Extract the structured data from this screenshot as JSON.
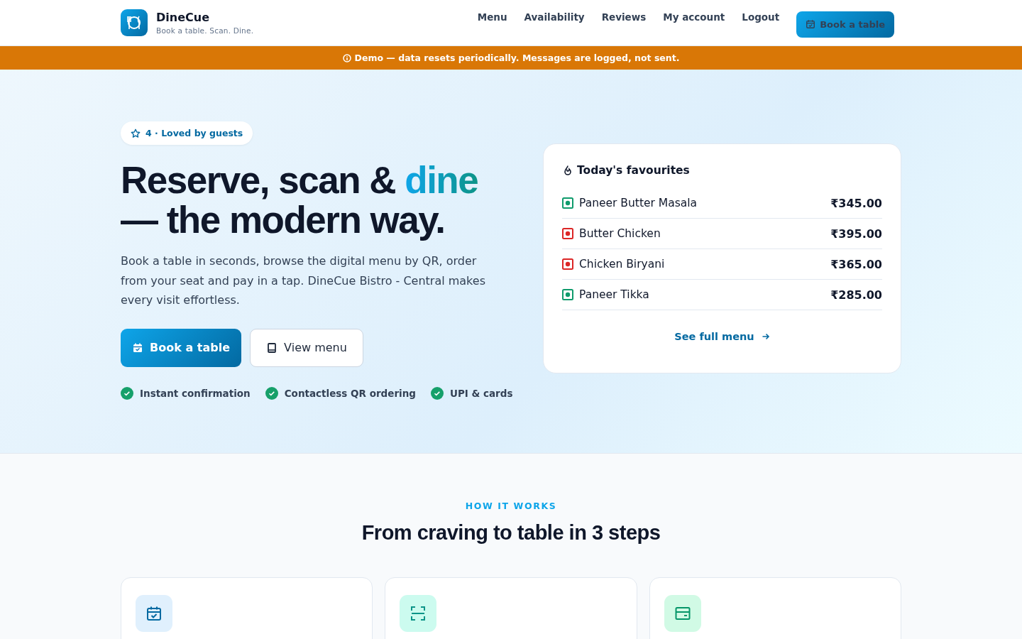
{
  "brand": {
    "name": "DineCue",
    "tagline": "Book a table. Scan. Dine."
  },
  "nav": {
    "links": [
      "Menu",
      "Availability",
      "Reviews",
      "My account",
      "Logout"
    ],
    "cta": "Book a table"
  },
  "banner": "Demo — data resets periodically. Messages are logged, not sent.",
  "hero": {
    "badge": "4 · Loved by guests",
    "headline_start": "Reserve, scan & ",
    "headline_accent": "dine",
    "headline_end": "— the modern way.",
    "lead": "Book a table in seconds, browse the digital menu by QR, order from your seat and pay in a tap. DineCue Bistro - Central makes every visit effortless.",
    "buttons": [
      {
        "label": "Book a table",
        "kind": "primary"
      },
      {
        "label": "View menu",
        "kind": "secondary"
      }
    ],
    "features": [
      "Instant confirmation",
      "Contactless QR ordering",
      "UPI & cards"
    ]
  },
  "favourites": {
    "title": "Today's favourites",
    "items": [
      {
        "name": "Paneer Butter Masala",
        "price": "₹345.00",
        "kind": "veg"
      },
      {
        "name": "Butter Chicken",
        "price": "₹395.00",
        "kind": "nonveg"
      },
      {
        "name": "Chicken Biryani",
        "price": "₹365.00",
        "kind": "nonveg"
      },
      {
        "name": "Paneer Tikka",
        "price": "₹285.00",
        "kind": "veg"
      }
    ],
    "link": "See full menu"
  },
  "steps": {
    "eyebrow": "HOW IT WORKS",
    "title": "From craving to table in 3 steps",
    "cards": [
      {
        "kind": "calendar"
      },
      {
        "kind": "scan"
      },
      {
        "kind": "card"
      }
    ]
  }
}
